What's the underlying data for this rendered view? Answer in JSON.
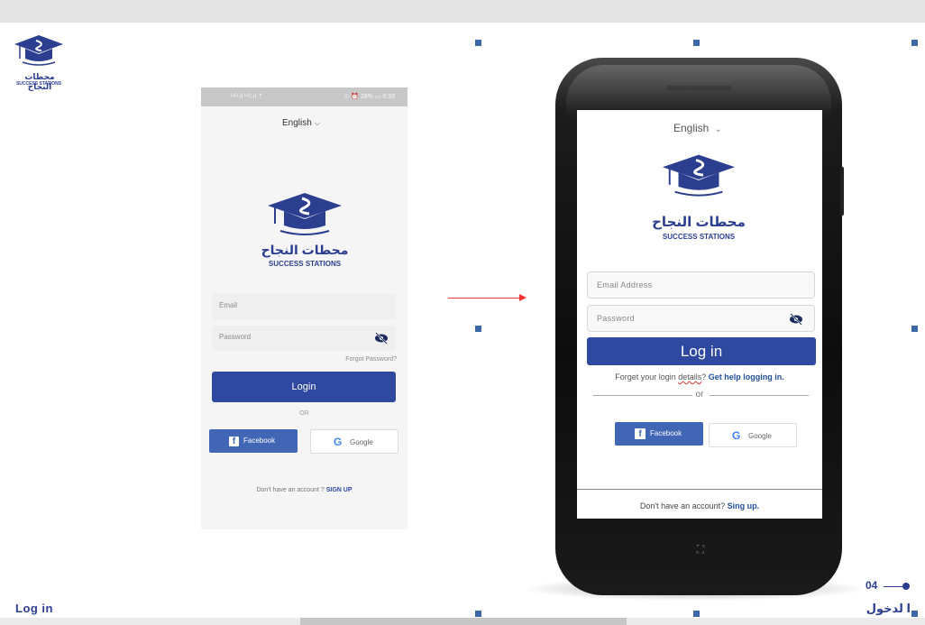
{
  "brand": {
    "name_ar": "محطات النجاح",
    "name_en": "SUCCESS STATIONS",
    "color": "#2c3e8f"
  },
  "left_screen": {
    "status_left": "ᴵ⁴ᴳ.ıl ᴵ⁴ᴳ.ıl ⇡",
    "status_right": "⊙ ⏰ 28% ▭ 6:33",
    "language": "English",
    "email_placeholder": "Email",
    "password_placeholder": "Password",
    "forgot_password": "Forgot Password?",
    "login_label": "Login",
    "or_label": "OR",
    "facebook_label": "Facebook",
    "google_label": "Google",
    "no_account_text": "Don't have an account ?",
    "sign_up_label": "SIGN UP"
  },
  "right_screen": {
    "language": "English",
    "email_placeholder": "Email Address",
    "password_placeholder": "Password",
    "login_label": "Log in",
    "forgot_text_a": "Forget your login ",
    "forgot_text_typo": "details",
    "forgot_text_b": "?",
    "get_help_label": "Get help logging in.",
    "or_label": "or",
    "facebook_label": "Facebook",
    "google_label": "Google",
    "no_account_text": "Don't have an account?",
    "sign_up_label": "Sing up."
  },
  "footer": {
    "page_number": "04",
    "title_en": "Log in",
    "title_ar": "ا لدخول"
  },
  "colors": {
    "accent": "#2f48a0",
    "arrow": "#e33333",
    "handle": "#3d68a8"
  }
}
